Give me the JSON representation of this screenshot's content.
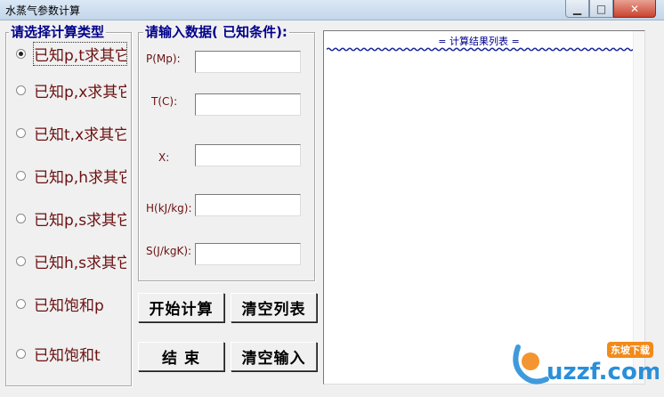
{
  "window": {
    "title": "水蒸气参数计算",
    "minimize_glyph": "▁",
    "maximize_glyph": "□",
    "close_glyph": "✕"
  },
  "calc_type_group": {
    "title": "请选择计算类型",
    "options": [
      {
        "label": "已知p,t求其它",
        "checked": true
      },
      {
        "label": "已知p,x求其它",
        "checked": false
      },
      {
        "label": "已知t,x求其它",
        "checked": false
      },
      {
        "label": "已知p,h求其它",
        "checked": false
      },
      {
        "label": "已知p,s求其它",
        "checked": false
      },
      {
        "label": "已知h,s求其它",
        "checked": false
      },
      {
        "label": "已知饱和p",
        "checked": false
      },
      {
        "label": "已知饱和t",
        "checked": false
      }
    ]
  },
  "input_group": {
    "title": "请输入数据( 已知条件):",
    "fields": [
      {
        "label": "P(Mp):",
        "value": ""
      },
      {
        "label": "T(C):",
        "value": ""
      },
      {
        "label": "X:",
        "value": ""
      },
      {
        "label": "H(kJ/kg):",
        "value": ""
      },
      {
        "label": "S(J/kgK):",
        "value": ""
      }
    ]
  },
  "buttons": {
    "start": "开始计算",
    "clear_list": "清空列表",
    "end": "结  束",
    "clear_input": "清空输入"
  },
  "results": {
    "header": "= 计算结果列表 ="
  },
  "watermark": {
    "text": "uzzf.com",
    "badge": "东坡下载"
  }
}
